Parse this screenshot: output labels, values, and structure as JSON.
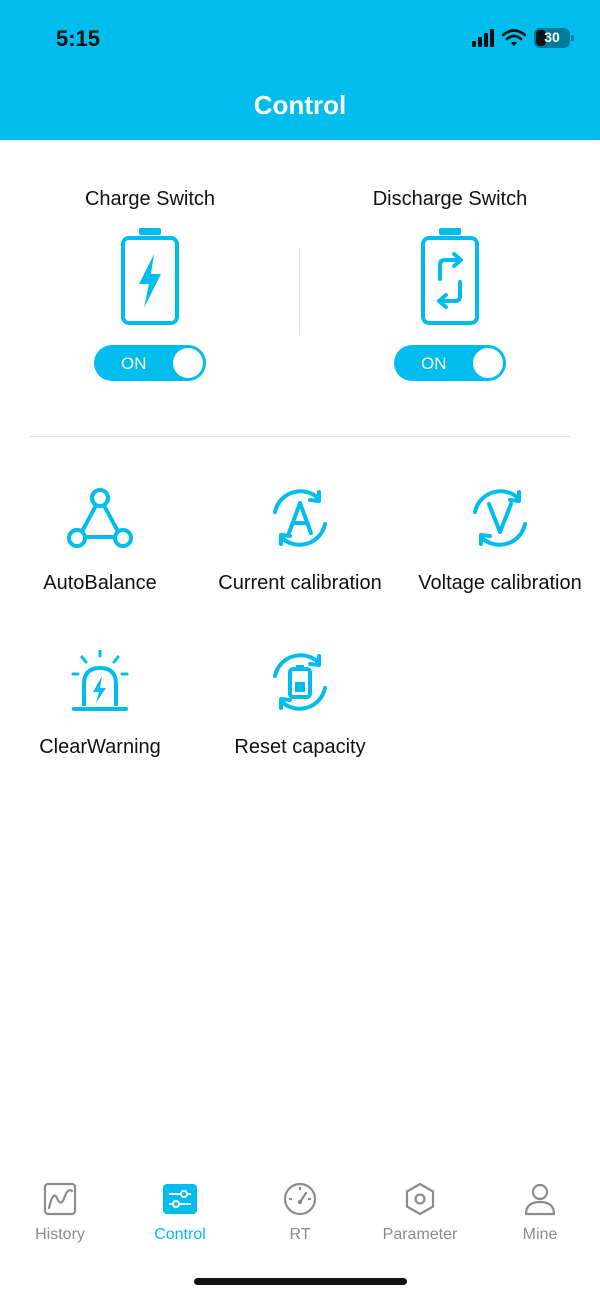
{
  "status_bar": {
    "time": "5:15",
    "battery_level": "30"
  },
  "header": {
    "title": "Control"
  },
  "switches": [
    {
      "label": "Charge Switch",
      "state": "ON",
      "icon": "charge-battery-icon"
    },
    {
      "label": "Discharge Switch",
      "state": "ON",
      "icon": "discharge-battery-icon"
    }
  ],
  "functions": [
    {
      "label": "AutoBalance",
      "icon": "triangle-nodes-icon"
    },
    {
      "label": "Current calibration",
      "icon": "current-a-icon"
    },
    {
      "label": "Voltage calibration",
      "icon": "voltage-v-icon"
    },
    {
      "label": "ClearWarning",
      "icon": "alarm-light-icon"
    },
    {
      "label": "Reset capacity",
      "icon": "reset-battery-icon"
    }
  ],
  "tabs": [
    {
      "label": "History",
      "icon": "chart-icon",
      "active": false
    },
    {
      "label": "Control",
      "icon": "sliders-icon",
      "active": true
    },
    {
      "label": "RT",
      "icon": "gauge-icon",
      "active": false
    },
    {
      "label": "Parameter",
      "icon": "hexagon-icon",
      "active": false
    },
    {
      "label": "Mine",
      "icon": "user-icon",
      "active": false
    }
  ],
  "colors": {
    "accent": "#00BDEE",
    "inactive_tab": "#8C8C8C",
    "text": "#111111"
  }
}
